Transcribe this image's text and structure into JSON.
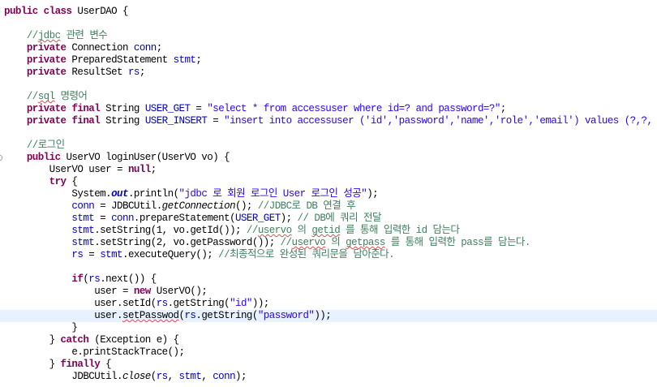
{
  "editor": {
    "theme": {
      "background": "#FFFFFF",
      "text": "#000000",
      "keyword": "#7F0055",
      "field": "#0000C0",
      "string": "#2A00FF",
      "comment": "#3F7F5F",
      "current_line": "#E8F2FE",
      "squiggle": "#D94F4F"
    },
    "current_line_index": 25,
    "lines": [
      [
        {
          "keyword": "public"
        },
        {
          "text": " "
        },
        {
          "keyword": "class"
        },
        {
          "text": " UserDAO {"
        }
      ],
      [],
      [
        {
          "text": "\t"
        },
        {
          "comment": "//"
        },
        {
          "comment_misspelled": "jdbc"
        },
        {
          "comment": " 관련 변수"
        }
      ],
      [
        {
          "text": "\t"
        },
        {
          "keyword": "private"
        },
        {
          "text": " Connection "
        },
        {
          "field": "conn"
        },
        {
          "text": ";"
        }
      ],
      [
        {
          "text": "\t"
        },
        {
          "keyword": "private"
        },
        {
          "text": " PreparedStatement "
        },
        {
          "field": "stmt"
        },
        {
          "text": ";"
        }
      ],
      [
        {
          "text": "\t"
        },
        {
          "keyword": "private"
        },
        {
          "text": " ResultSet "
        },
        {
          "field": "rs"
        },
        {
          "text": ";"
        }
      ],
      [],
      [
        {
          "text": "\t"
        },
        {
          "comment": "//"
        },
        {
          "comment_misspelled": "sql"
        },
        {
          "comment": " 명령어"
        }
      ],
      [
        {
          "text": "\t"
        },
        {
          "keyword": "private"
        },
        {
          "text": " "
        },
        {
          "keyword": "final"
        },
        {
          "text": " String "
        },
        {
          "field": "USER_GET"
        },
        {
          "text": " = "
        },
        {
          "string": "\"select * from accessuser where id=? and password=?\""
        },
        {
          "text": ";"
        }
      ],
      [
        {
          "text": "\t"
        },
        {
          "keyword": "private"
        },
        {
          "text": " "
        },
        {
          "keyword": "final"
        },
        {
          "text": " String "
        },
        {
          "field": "USER_INSERT"
        },
        {
          "text": " = "
        },
        {
          "string": "\"insert into accessuser ('id','password','name','role','email') values (?,?,"
        }
      ],
      [],
      [
        {
          "text": "\t"
        },
        {
          "comment": "//로그인"
        }
      ],
      [
        {
          "text": "\t"
        },
        {
          "keyword": "public"
        },
        {
          "text": " UserVO loginUser(UserVO vo) {"
        }
      ],
      [
        {
          "text": "\t\tUserVO user = "
        },
        {
          "keyword": "null"
        },
        {
          "text": ";"
        }
      ],
      [
        {
          "text": "\t\t"
        },
        {
          "keyword": "try"
        },
        {
          "text": " {"
        }
      ],
      [
        {
          "text": "\t\t\tSystem."
        },
        {
          "static_field": "out"
        },
        {
          "text": ".println("
        },
        {
          "string": "\"jdbc 로 회원 로그인 User 로그인 성공\""
        },
        {
          "text": ");"
        }
      ],
      [
        {
          "text": "\t\t\t"
        },
        {
          "field": "conn"
        },
        {
          "text": " = JDBCUtil."
        },
        {
          "static_method": "getConnection"
        },
        {
          "text": "(); "
        },
        {
          "comment": "//JDBC로 DB 연결 후"
        }
      ],
      [
        {
          "text": "\t\t\t"
        },
        {
          "field": "stmt"
        },
        {
          "text": " = "
        },
        {
          "field": "conn"
        },
        {
          "text": ".prepareStatement("
        },
        {
          "field": "USER_GET"
        },
        {
          "text": "); "
        },
        {
          "comment": "// DB에 쿼리 전달"
        }
      ],
      [
        {
          "text": "\t\t\t"
        },
        {
          "field": "stmt"
        },
        {
          "text": ".setString(1, vo.getId()); "
        },
        {
          "comment": "//"
        },
        {
          "comment_misspelled": "uservo"
        },
        {
          "comment": " 의 "
        },
        {
          "comment_misspelled": "getid"
        },
        {
          "comment": " 를 통해 입력한 id 담는다"
        }
      ],
      [
        {
          "text": "\t\t\t"
        },
        {
          "field": "stmt"
        },
        {
          "text": ".setString(2, vo.getPassword()); "
        },
        {
          "comment": "//"
        },
        {
          "comment_misspelled": "uservo"
        },
        {
          "comment": " 의 "
        },
        {
          "comment_misspelled": "getpass"
        },
        {
          "comment": " 를 통해 입력한 pass를 담는다."
        }
      ],
      [
        {
          "text": "\t\t\t"
        },
        {
          "field": "rs"
        },
        {
          "text": " = "
        },
        {
          "field": "stmt"
        },
        {
          "text": ".executeQuery(); "
        },
        {
          "comment": "//최종적으로 완성된 쿼리문을 담아준다."
        }
      ],
      [],
      [
        {
          "text": "\t\t\t"
        },
        {
          "keyword": "if"
        },
        {
          "text": "("
        },
        {
          "field": "rs"
        },
        {
          "text": ".next()) {"
        }
      ],
      [
        {
          "text": "\t\t\t\tuser = "
        },
        {
          "keyword": "new"
        },
        {
          "text": " UserVO();"
        }
      ],
      [
        {
          "text": "\t\t\t\tuser.setId("
        },
        {
          "field": "rs"
        },
        {
          "text": ".getString("
        },
        {
          "string": "\"id\""
        },
        {
          "text": "));"
        }
      ],
      [
        {
          "text": "\t\t\t\tuser."
        },
        {
          "text_misspelled": "setPasswod"
        },
        {
          "text": "("
        },
        {
          "field": "rs"
        },
        {
          "text": ".getString("
        },
        {
          "string": "\"password\""
        },
        {
          "text": "));"
        }
      ],
      [
        {
          "text": "\t\t\t}"
        }
      ],
      [
        {
          "text": "\t\t} "
        },
        {
          "keyword": "catch"
        },
        {
          "text": " (Exception e) {"
        }
      ],
      [
        {
          "text": "\t\t\te.printStackTrace();"
        }
      ],
      [
        {
          "text": "\t\t} "
        },
        {
          "keyword": "finally"
        },
        {
          "text": " {"
        }
      ],
      [
        {
          "text": "\t\t\tJDBCUtil."
        },
        {
          "static_method": "close"
        },
        {
          "text": "("
        },
        {
          "field": "rs"
        },
        {
          "text": ", "
        },
        {
          "field": "stmt"
        },
        {
          "text": ", "
        },
        {
          "field": "conn"
        },
        {
          "text": ");"
        }
      ]
    ]
  }
}
